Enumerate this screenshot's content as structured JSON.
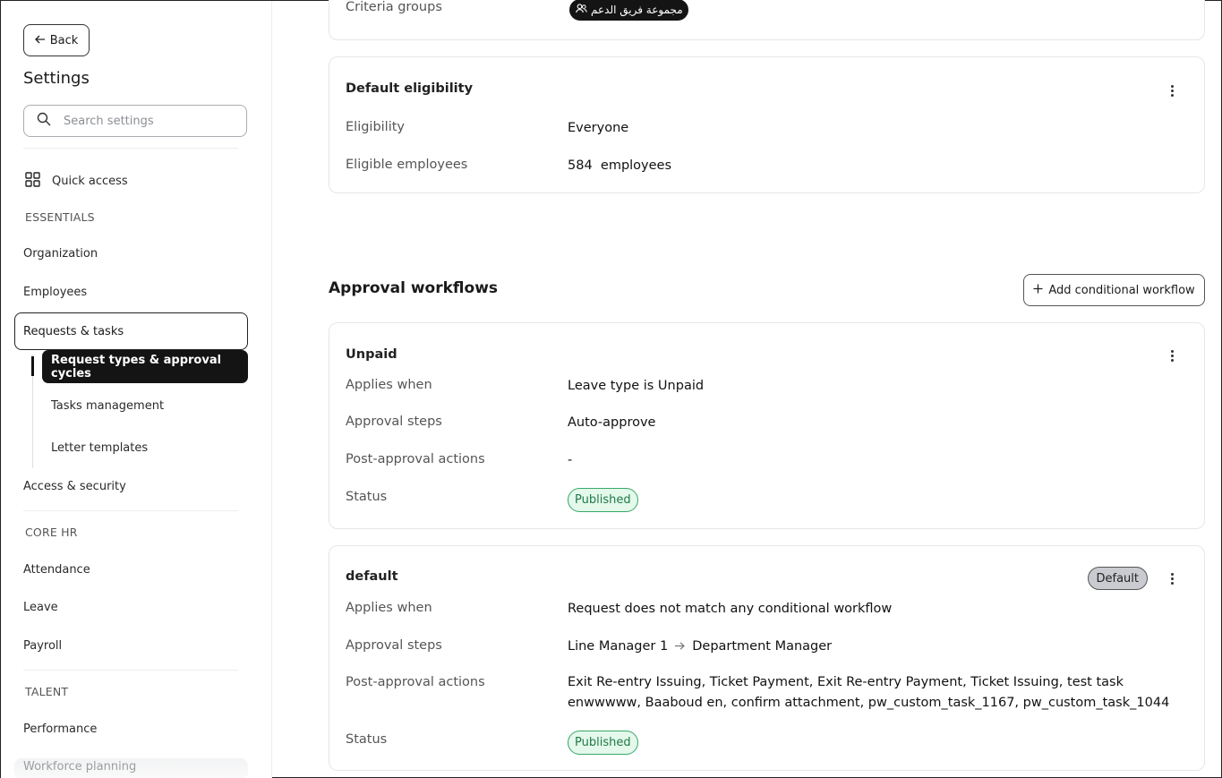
{
  "sidebar": {
    "back_label": "Back",
    "title": "Settings",
    "search_placeholder": "Search settings",
    "quick_access": "Quick access",
    "sections": {
      "essentials": "ESSENTIALS",
      "core_hr": "CORE HR",
      "talent": "TALENT"
    },
    "items": {
      "organization": "Organization",
      "employees": "Employees",
      "requests_tasks": "Requests & tasks",
      "request_types": "Request types & approval cycles",
      "tasks_management": "Tasks management",
      "letter_templates": "Letter templates",
      "access_security": "Access & security",
      "attendance": "Attendance",
      "leave": "Leave",
      "payroll": "Payroll",
      "performance": "Performance",
      "workforce_planning": "Workforce planning"
    }
  },
  "criteria_card": {
    "label": "Criteria groups",
    "group_chip": "مجموعة فريق الدعم"
  },
  "eligibility_card": {
    "title": "Default eligibility",
    "rows": [
      {
        "label": "Eligibility",
        "value": "Everyone"
      },
      {
        "label": "Eligible employees",
        "value": "584  employees"
      }
    ]
  },
  "approval": {
    "heading": "Approval workflows",
    "add_button": "Add conditional workflow",
    "workflows": [
      {
        "title": "Unpaid",
        "applies_label": "Applies when",
        "applies_value": "Leave type is Unpaid",
        "steps_label": "Approval steps",
        "steps_value": "Auto-approve",
        "post_label": "Post-approval actions",
        "post_value": "-",
        "status_label": "Status",
        "status_value": "Published"
      },
      {
        "title": "default",
        "badge": "Default",
        "applies_label": "Applies when",
        "applies_value": "Request does not match any conditional workflow",
        "steps_label": "Approval steps",
        "step_1": "Line Manager 1",
        "step_2": "Department Manager",
        "post_label": "Post-approval actions",
        "post_value_line1": "Exit Re-entry Issuing, Ticket Payment, Exit Re-entry Payment, Ticket Issuing, test task",
        "post_value_line2": "enwwwww, Baaboud en, confirm attachment, pw_custom_task_1167, pw_custom_task_1044",
        "status_label": "Status",
        "status_value": "Published"
      }
    ]
  }
}
